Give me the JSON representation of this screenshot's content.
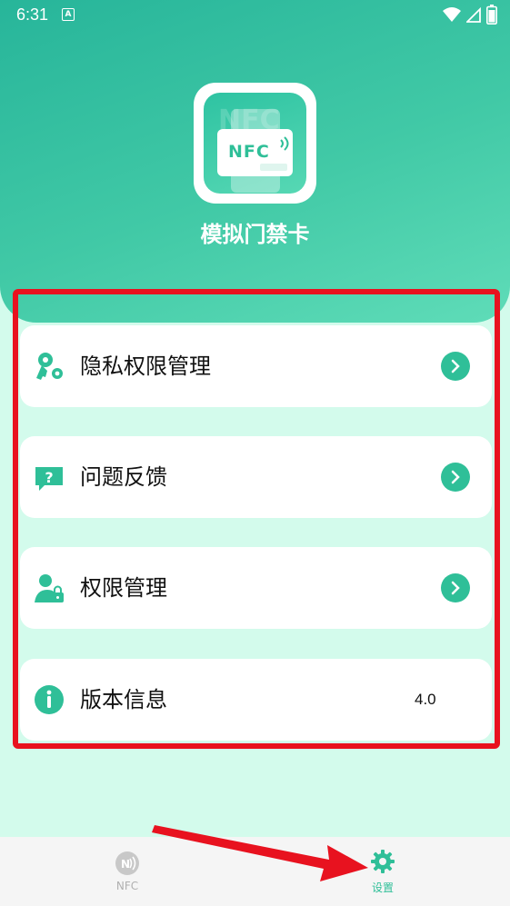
{
  "status_bar": {
    "time": "6:31",
    "notification_glyph": "A"
  },
  "app": {
    "title": "模拟门禁卡",
    "icon_text": "NFC"
  },
  "menu": {
    "items": [
      {
        "label": "隐私权限管理",
        "icon": "key-gear-icon",
        "action": "chevron-right-icon"
      },
      {
        "label": "问题反馈",
        "icon": "question-bubble-icon",
        "action": "chevron-right-icon"
      },
      {
        "label": "权限管理",
        "icon": "user-lock-icon",
        "action": "chevron-right-icon"
      },
      {
        "label": "版本信息",
        "icon": "info-icon",
        "value": "4.0"
      }
    ]
  },
  "bottom_nav": {
    "tabs": [
      {
        "label": "NFC",
        "icon": "nfc-icon",
        "active": false
      },
      {
        "label": "设置",
        "icon": "gear-icon",
        "active": true
      }
    ]
  },
  "colors": {
    "accent": "#2fbf98",
    "annotation": "#e8121f",
    "background": "#d3fbec"
  }
}
